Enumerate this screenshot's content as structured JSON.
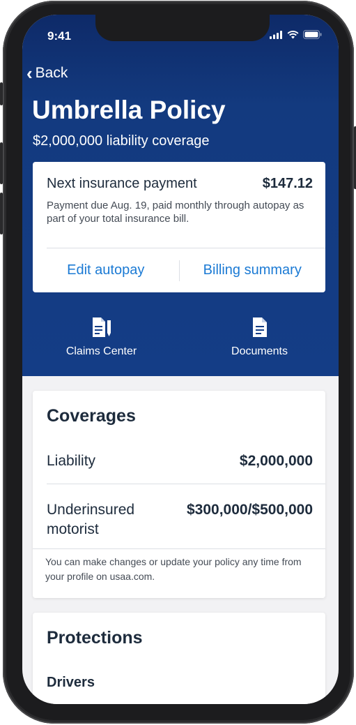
{
  "status_bar": {
    "time": "9:41"
  },
  "nav": {
    "back_label": "Back"
  },
  "policy": {
    "title": "Umbrella Policy",
    "subtitle": "$2,000,000 liability coverage"
  },
  "payment_card": {
    "label": "Next insurance payment",
    "amount": "$147.12",
    "note": "Payment due Aug. 19, paid monthly through autopay as part of your total insurance bill.",
    "edit_autopay_label": "Edit autopay",
    "billing_summary_label": "Billing summary"
  },
  "quick_actions": [
    {
      "label": "Claims Center",
      "icon": "claims-document-pen-icon"
    },
    {
      "label": "Documents",
      "icon": "document-icon"
    }
  ],
  "coverages": {
    "title": "Coverages",
    "items": [
      {
        "name": "Liability",
        "value": "$2,000,000"
      },
      {
        "name": "Underinsured motorist",
        "value": "$300,000/$500,000"
      }
    ],
    "note": "You can make changes or update your policy any time from your profile on usaa.com."
  },
  "protections": {
    "title": "Protections",
    "first_item": "Drivers"
  },
  "colors": {
    "header_blue": "#143d86",
    "link_blue": "#1b7ad4",
    "text_dark": "#1d2b3c"
  }
}
